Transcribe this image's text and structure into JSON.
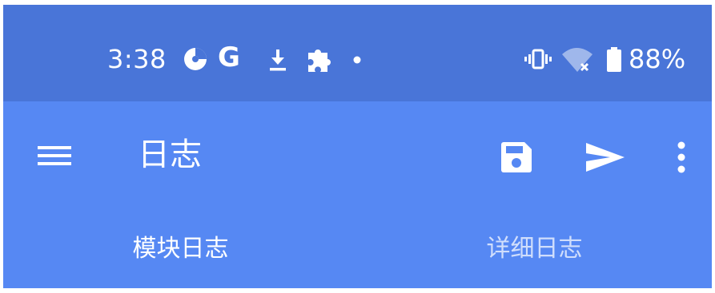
{
  "status_bar": {
    "time": "3:38",
    "battery_percent": "88%",
    "icons": [
      "data-saver-icon",
      "google-icon",
      "download-icon",
      "puzzle-icon",
      "dot-icon",
      "vibrate-icon",
      "wifi-off-icon",
      "battery-icon"
    ]
  },
  "toolbar": {
    "title": "日志",
    "actions": [
      "menu-icon",
      "save-icon",
      "send-icon",
      "more-vert-icon"
    ]
  },
  "tabs": [
    {
      "label": "模块日志",
      "active": true
    },
    {
      "label": "详细日志",
      "active": false
    }
  ],
  "colors": {
    "status_bar": "#4975D8",
    "toolbar": "#5688F3",
    "indicator": "#FFFFFF"
  }
}
